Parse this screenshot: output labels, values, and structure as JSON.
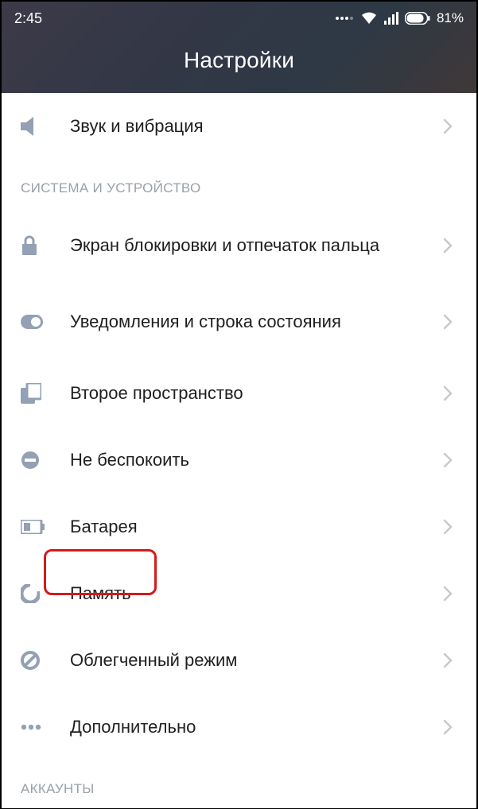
{
  "status": {
    "time": "2:45",
    "battery_pct": "81%"
  },
  "header": {
    "title": "Настройки"
  },
  "rows": {
    "sound": "Звук и вибрация",
    "lockscreen": "Экран блокировки и отпечаток пальца",
    "notifications": "Уведомления и строка состояния",
    "second_space": "Второе пространство",
    "dnd": "Не беспокоить",
    "battery": "Батарея",
    "storage": "Память",
    "lite_mode": "Облегченный режим",
    "additional": "Дополнительно"
  },
  "sections": {
    "system_device": "СИСТЕМА И УСТРОЙСТВО",
    "accounts": "АККАУНТЫ"
  }
}
